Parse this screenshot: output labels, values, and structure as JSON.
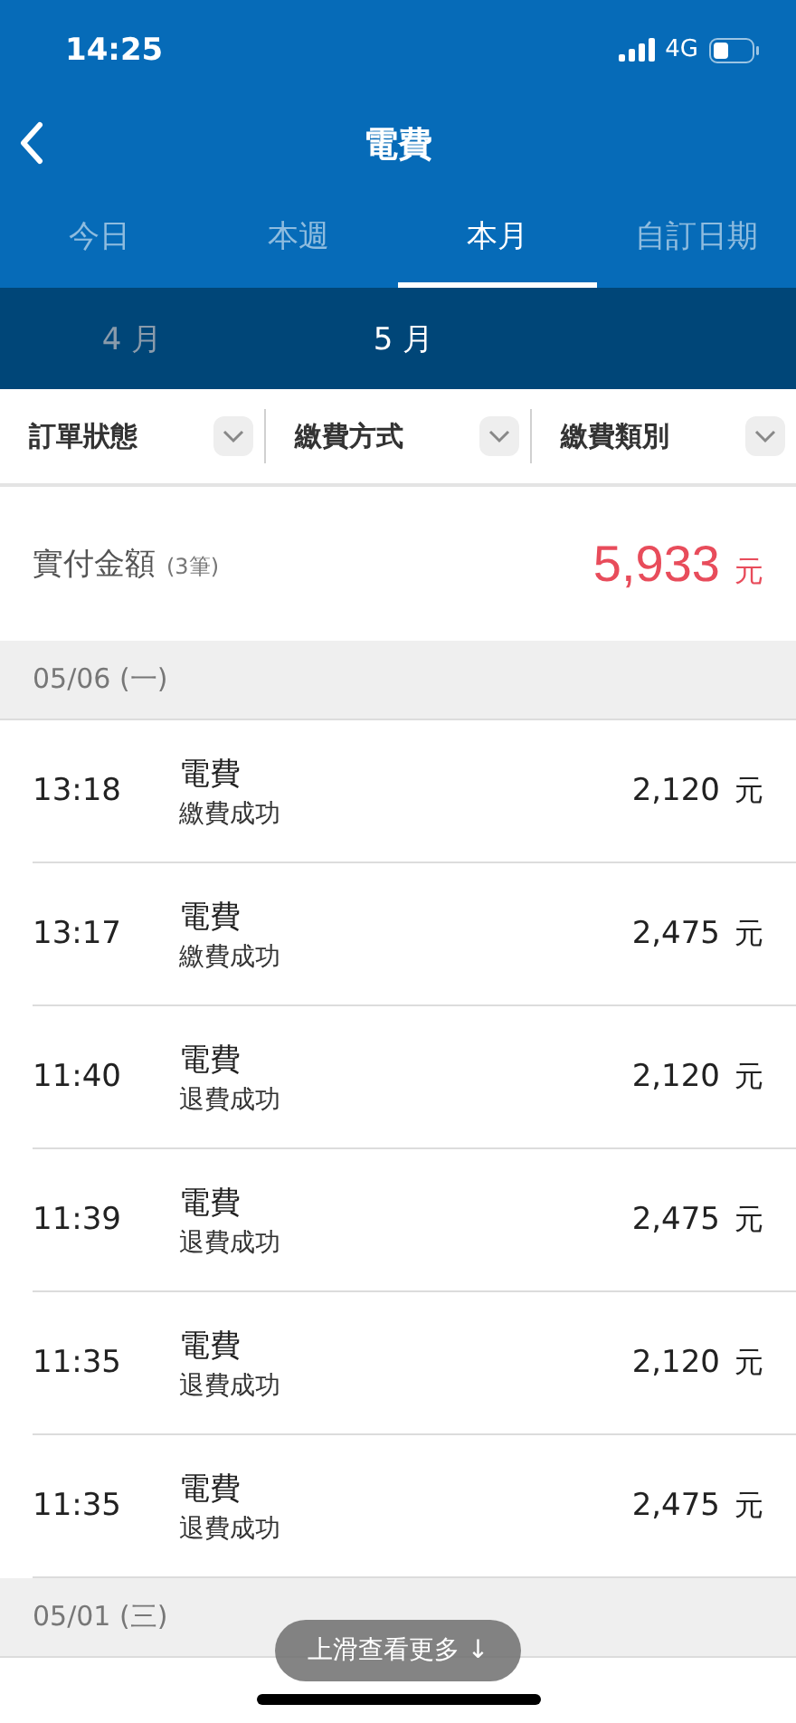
{
  "status_bar": {
    "time": "14:25",
    "network": "4G"
  },
  "nav": {
    "title": "電費"
  },
  "tabs": [
    {
      "label": "今日",
      "selected": false
    },
    {
      "label": "本週",
      "selected": false
    },
    {
      "label": "本月",
      "selected": true
    },
    {
      "label": "自訂日期",
      "selected": false
    }
  ],
  "months": [
    {
      "label": "4 月",
      "selected": false
    },
    {
      "label": "5 月",
      "selected": true
    }
  ],
  "filters": [
    {
      "label": "訂單狀態"
    },
    {
      "label": "繳費方式"
    },
    {
      "label": "繳費類別"
    }
  ],
  "summary": {
    "label": "實付金額",
    "count": "(3筆)",
    "amount": "5,933",
    "unit": "元"
  },
  "groups": [
    {
      "date": "05/06 (一)",
      "rows": [
        {
          "time": "13:18",
          "title": "電費",
          "status": "繳費成功",
          "amount": "2,120",
          "unit": "元"
        },
        {
          "time": "13:17",
          "title": "電費",
          "status": "繳費成功",
          "amount": "2,475",
          "unit": "元"
        },
        {
          "time": "11:40",
          "title": "電費",
          "status": "退費成功",
          "amount": "2,120",
          "unit": "元"
        },
        {
          "time": "11:39",
          "title": "電費",
          "status": "退費成功",
          "amount": "2,475",
          "unit": "元"
        },
        {
          "time": "11:35",
          "title": "電費",
          "status": "退費成功",
          "amount": "2,120",
          "unit": "元"
        },
        {
          "time": "11:35",
          "title": "電費",
          "status": "退費成功",
          "amount": "2,475",
          "unit": "元"
        }
      ]
    },
    {
      "date": "05/01 (三)"
    }
  ],
  "scroll_hint": "上滑查看更多 ↓"
}
